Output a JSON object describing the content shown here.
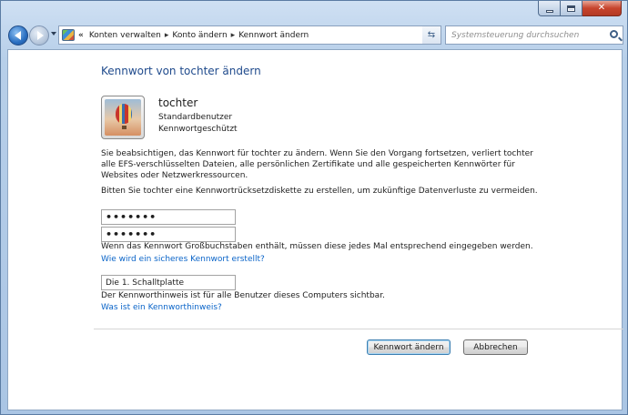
{
  "window": {
    "caption": {
      "minimize": "",
      "maximize": "",
      "close": "✕"
    }
  },
  "nav": {
    "breadcrumbs": [
      "Konten verwalten",
      "Konto ändern",
      "Kennwort ändern"
    ],
    "overflow": "«",
    "search_placeholder": "Systemsteuerung durchsuchen"
  },
  "page": {
    "title": "Kennwort von tochter ändern",
    "user": {
      "name": "tochter",
      "type": "Standardbenutzer",
      "status": "Kennwortgeschützt"
    },
    "warning": "Sie beabsichtigen, das Kennwort für tochter zu ändern. Wenn Sie den Vorgang fortsetzen, verliert tochter alle EFS-verschlüsselten Dateien, alle persönlichen Zertifikate und alle gespeicherten Kennwörter für Websites oder Netzwerkressourcen.",
    "reset_disk_note": "Bitten Sie tochter eine Kennwortrücksetzdiskette zu erstellen, um zukünftige Datenverluste zu vermeiden.",
    "new_password_value": "•••••••",
    "confirm_password_value": "•••••••",
    "caps_note": "Wenn das Kennwort Großbuchstaben enthält, müssen diese jedes Mal entsprechend eingegeben werden.",
    "secure_password_link": "Wie wird ein sicheres Kennwort erstellt?",
    "hint_value": "Die 1. Schalltplatte",
    "hint_note": "Der Kennworthinweis ist für alle Benutzer dieses Computers sichtbar.",
    "hint_link": "Was ist ein Kennworthinweis?",
    "change_button": "Kennwort ändern",
    "cancel_button": "Abbrechen"
  },
  "colors": {
    "title": "#1f4a8c",
    "link": "#0a64c8",
    "frame": "#aac5e4"
  },
  "icons": {
    "back": "back-arrow-icon",
    "forward": "forward-arrow-icon",
    "control_panel": "control-panel-icon",
    "refresh": "refresh-icon",
    "search": "search-icon",
    "user_picture": "hot-air-balloon-icon"
  }
}
